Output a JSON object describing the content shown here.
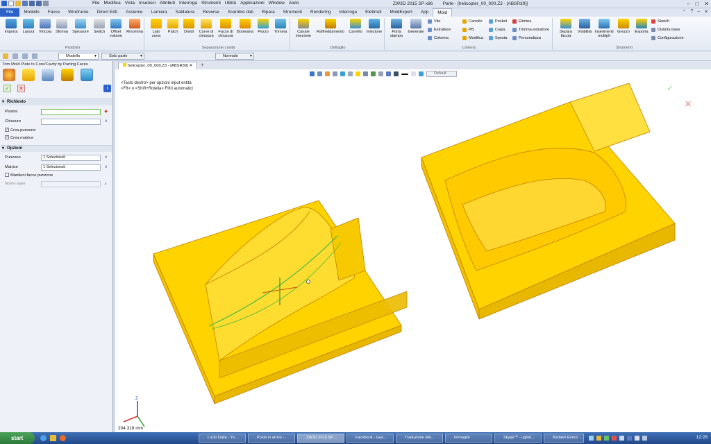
{
  "window": {
    "title": "ZW3D 2015 SP x86",
    "document": "Parte - [helicopter_00_000.Z3 - [ABSR39]]"
  },
  "menu": [
    "File",
    "Modifica",
    "Vista",
    "Inserisci",
    "Attributi",
    "Interroga",
    "Strumenti",
    "Utilità",
    "Applicazioni",
    "Window",
    "Aiuto"
  ],
  "tabs": [
    "File",
    "Modello",
    "Facce",
    "Wireframe",
    "Direct Edit",
    "Assieme",
    "Lamiera",
    "Saldatura",
    "Reverse",
    "Scambio dati",
    "Ripara",
    "Strumenti",
    "Rendering",
    "Interroga",
    "Elettrodi",
    "MoldExpert",
    "App",
    "Mold"
  ],
  "active_tab": "Mold",
  "ribbon": {
    "groups": [
      "Prodotto",
      "Separazione cavità",
      "Dettaglio",
      "Libreria",
      "Strumenti"
    ],
    "prodotto": [
      "Importa",
      "Layout",
      "Vincola",
      "Sforma",
      "Spessore",
      "Switch",
      "Offset volume",
      "Rinomina"
    ],
    "separazione": [
      "Lato zona",
      "Patch",
      "Dividi",
      "Curve di chiusura",
      "Facce di chiusura",
      "Booleana",
      "Pezzo",
      "Trimma"
    ],
    "dettaglio": [
      "Canale iniezione",
      "Raffreddamento",
      "Carrello",
      "Iniezione"
    ],
    "libreria_big": [
      "Porta stampo",
      "Generale"
    ],
    "libreria_col1": [
      "Vite",
      "Estrattore",
      "Colonna"
    ],
    "libreria_col2": [
      "Carrello",
      "PB",
      "Modifica"
    ],
    "libreria_col3": [
      "Pocket",
      "Copia",
      "Sposta"
    ],
    "libreria_col4": [
      "Elimina",
      "Trimma estrattore",
      "Personalizza"
    ],
    "strumenti_big": [
      "Separa faccia",
      "Visibilità",
      "Inserimenti multipli",
      "Grezzo",
      "Esporta"
    ],
    "strumenti_small": [
      "Sketch",
      "Distinta base",
      "Configurazione"
    ]
  },
  "selbar": {
    "filter": "Modello",
    "parts": "Solo parte",
    "style": "Normale"
  },
  "panel": {
    "title": "Trim Mold Plate to Core/Cavity by Parting Faces",
    "required_header": "Richiesto",
    "piastra_label": "Piastra",
    "piastra_value": "",
    "chiusure_label": "Chiusure",
    "chiusure_value": "",
    "crea_punzone": "Crea punzone",
    "crea_matrice": "Crea matrice",
    "options_header": "Opzioni",
    "punzone_label": "Punzone",
    "punzone_value": "1 Selezionati",
    "matrice_label": "Matrice",
    "matrice_value": "1 Selezionati",
    "mantieni": "Mantieni facce punzone",
    "nome_layer": "Nome layer"
  },
  "doc_tab": "helicopter_00_000.Z3 - [ABSR39]",
  "viewport": {
    "hint1": "<Tasto destro> per opzioni input entità",
    "hint2": "<F8> o <Shift+Rotella> Filtri automatici",
    "scale": "204.318 mm",
    "render_mode": "Default"
  },
  "taskbar": {
    "start": "start",
    "items": [
      "Lucio Dalla - Yo...",
      "Posta in arrivo -...",
      "ZW3D 2015 SP ...",
      "Facebook - Goo...",
      "Traduzione sito...",
      "Immagini",
      "Skype™ - ughet...",
      "Barbieri Enrico"
    ],
    "clock": "12:28"
  },
  "colors": {
    "model": "#ffd400",
    "accent": "#2a62c9",
    "ok": "#3aa03a",
    "cancel": "#d03030"
  }
}
